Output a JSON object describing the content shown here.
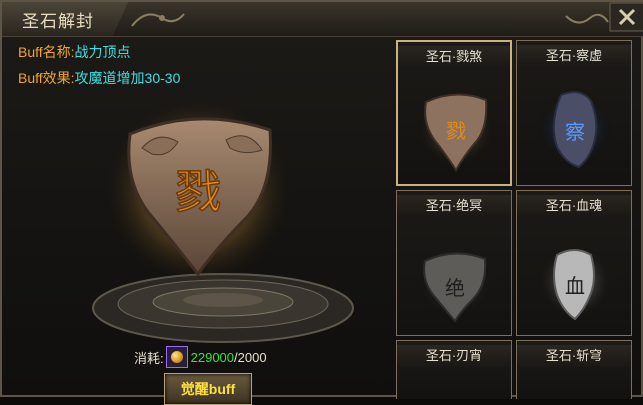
{
  "window": {
    "title": "圣石解封"
  },
  "buff": {
    "name_key": "Buff名称:",
    "name_value": "战力顶点",
    "effect_key": "Buff效果:",
    "effect_value": "攻魔道增加30-30"
  },
  "featured_stone": {
    "glyph": "戮",
    "icon": "holy-stone-icon",
    "color": "#8a6a52"
  },
  "cost": {
    "label": "消耗:",
    "current": "229000",
    "separator": "/",
    "required": "2000",
    "icon": "gold-coin-icon"
  },
  "awaken_button": {
    "label": "觉醒buff"
  },
  "stones": [
    {
      "title": "圣石·戮煞",
      "glyph": "戮",
      "style": "bronze",
      "selected": true
    },
    {
      "title": "圣石·察虚",
      "glyph": "察",
      "style": "blue",
      "selected": false
    },
    {
      "title": "圣石·绝冥",
      "glyph": "绝",
      "style": "gray",
      "selected": false
    },
    {
      "title": "圣石·血魂",
      "glyph": "血",
      "style": "white",
      "selected": false
    },
    {
      "title": "圣石·刃宵",
      "glyph": "",
      "style": "hidden",
      "selected": false
    },
    {
      "title": "圣石·斩穹",
      "glyph": "",
      "style": "hidden",
      "selected": false
    }
  ],
  "colors": {
    "key_orange": "#f0a52c",
    "value_cyan": "#3ee0e0",
    "cost_green": "#3ee03e",
    "button_text": "#ffe13a"
  }
}
